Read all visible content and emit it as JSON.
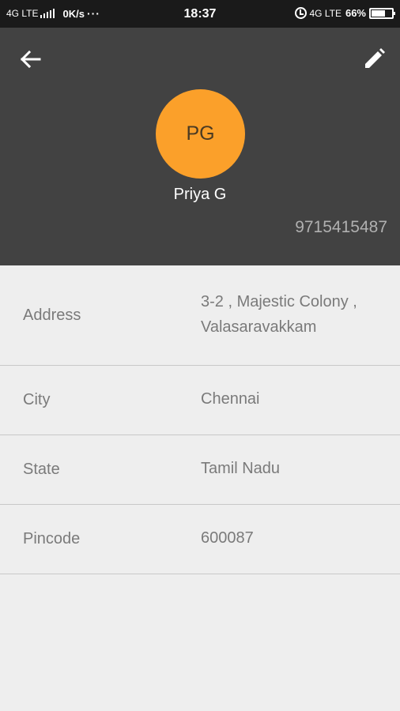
{
  "status_bar": {
    "network_left": "4G LTE",
    "speed": "0K/s",
    "more": "···",
    "time": "18:37",
    "network_right": "4G LTE",
    "battery": "66%",
    "battery_level": 0.66
  },
  "header": {
    "initials": "PG",
    "avatar_color": "#fba02a",
    "name": "Priya G",
    "phone": "9715415487",
    "back_icon": "arrow-back-icon",
    "edit_icon": "pencil-icon"
  },
  "details": [
    {
      "label": "Address",
      "value": "3-2 ,  Majestic Colony , Valasaravakkam"
    },
    {
      "label": "City",
      "value": "Chennai"
    },
    {
      "label": "State",
      "value": "Tamil Nadu"
    },
    {
      "label": "Pincode",
      "value": "600087"
    }
  ]
}
